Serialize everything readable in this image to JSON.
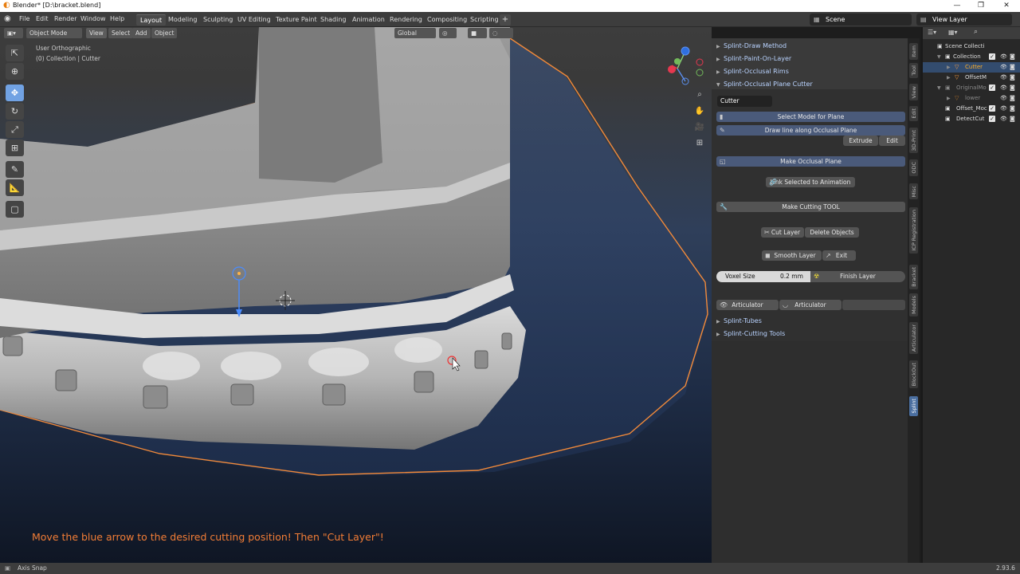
{
  "window": {
    "title": "Blender* [D:\\bracket.blend]"
  },
  "menu": [
    "File",
    "Edit",
    "Render",
    "Window",
    "Help"
  ],
  "workspaces": [
    "Layout",
    "Modeling",
    "Sculpting",
    "UV Editing",
    "Texture Paint",
    "Shading",
    "Animation",
    "Rendering",
    "Compositing",
    "Scripting"
  ],
  "active_workspace": "Layout",
  "scene": {
    "name": "Scene",
    "view_layer": "View Layer"
  },
  "viewport": {
    "mode": "Object Mode",
    "header_buttons": [
      "View",
      "Select",
      "Add",
      "Object"
    ],
    "orientation": "Global",
    "info_line1": "User Orthographic",
    "info_line2": "(0) Collection | Cutter",
    "hint": "Move the blue arrow to the desired cutting position! Then \"Cut Layer\"!"
  },
  "panel": {
    "sections_top": [
      "Splint-Draw Method",
      "Splint-Paint-On-Layer",
      "Splint-Occlusal Rims",
      "Splint-Occlusal Plane Cutter"
    ],
    "cutter_name": "Cutter",
    "select_model": "Select Model for Plane",
    "draw_line": "Draw line along Occlusal Plane",
    "extrude": "Extrude",
    "edit": "Edit",
    "make_plane": "Make Occlusal Plane",
    "link_anim": "Link Selected to Animation",
    "make_tool": "Make Cutting TOOL",
    "cut_layer": "Cut Layer",
    "delete_objects": "Delete Objects",
    "smooth_layer": "Smooth Layer",
    "exit": "Exit",
    "voxel_label": "Voxel Size",
    "voxel_value": "0.2 mm",
    "finish_layer": "Finish Layer",
    "articulator1": "Articulator",
    "articulator2": "Articulator",
    "sections_bottom": [
      "Splint-Tubes",
      "Splint-Cutting Tools"
    ]
  },
  "tabs": [
    "Item",
    "Tool",
    "View",
    "Edit",
    "3D-Print",
    "ODC",
    "Misc",
    "ICP Registration",
    "Bracket",
    "Models",
    "Articulator",
    "BlockOut",
    "Splint"
  ],
  "active_tab": "Splint",
  "outliner": {
    "rows": [
      {
        "name": "Scene Collecti",
        "type": "scene"
      },
      {
        "name": "Collection",
        "type": "collection"
      },
      {
        "name": "Cutter",
        "type": "object"
      },
      {
        "name": "OffsetM",
        "type": "object"
      },
      {
        "name": "OriginalMo",
        "type": "collection"
      },
      {
        "name": "lower",
        "type": "object"
      },
      {
        "name": "Offset_Moc",
        "type": "object"
      },
      {
        "name": "DetectCut",
        "type": "object"
      }
    ]
  },
  "status": {
    "left": "Axis Snap",
    "version": "2.93.6"
  },
  "colors": {
    "accent": "#4772b3",
    "hint": "#f27d36",
    "outline": "#f28a3a"
  }
}
